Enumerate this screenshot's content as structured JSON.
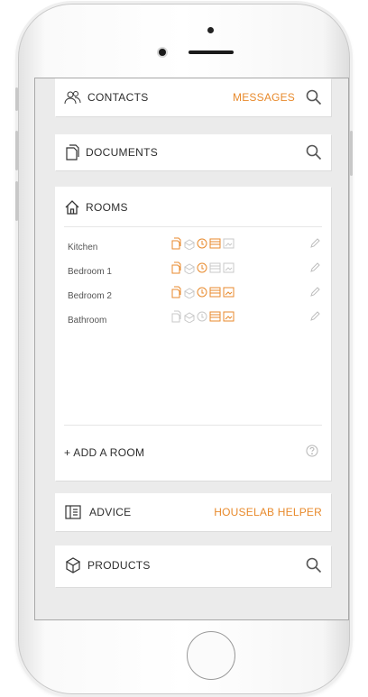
{
  "contacts": {
    "label": "CONTACTS",
    "action": "MESSAGES"
  },
  "documents": {
    "label": "DOCUMENTS"
  },
  "rooms": {
    "label": "ROOMS",
    "items": [
      {
        "name": "Kitchen"
      },
      {
        "name": "Bedroom 1"
      },
      {
        "name": "Bedroom 2"
      },
      {
        "name": "Bathroom"
      }
    ],
    "add_label": "+ ADD A ROOM"
  },
  "advice": {
    "label": "ADVICE",
    "action": "HOUSELAB HELPER"
  },
  "products": {
    "label": "PRODUCTS"
  },
  "colors": {
    "accent": "#e88a2c",
    "icon_inactive": "#c8c8c8"
  }
}
